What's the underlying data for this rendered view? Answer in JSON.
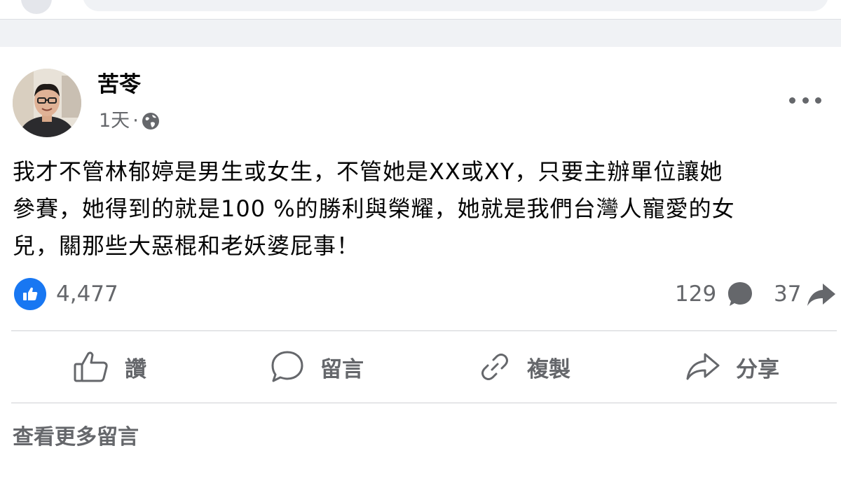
{
  "post": {
    "author": "苦苓",
    "time": "1天",
    "separator": "·",
    "privacy_icon": "globe-icon",
    "text_lines": [
      "我才不管林郁婷是男生或女生，不管她是XX或XY，只要主辦單位讓她",
      "參賽，她得到的就是100 %的勝利與榮耀，她就是我們台灣人寵愛的女",
      "兒，關那些大惡棍和老妖婆屁事！"
    ],
    "reactions": {
      "like_count": "4,477",
      "comment_count": "129",
      "share_count": "37"
    }
  },
  "actions": {
    "like": "讚",
    "comment": "留言",
    "copy": "複製",
    "share": "分享"
  },
  "more_comments": "查看更多留言",
  "colors": {
    "accent": "#1877f2",
    "secondary_text": "#65676b",
    "background": "#f0f2f5"
  }
}
